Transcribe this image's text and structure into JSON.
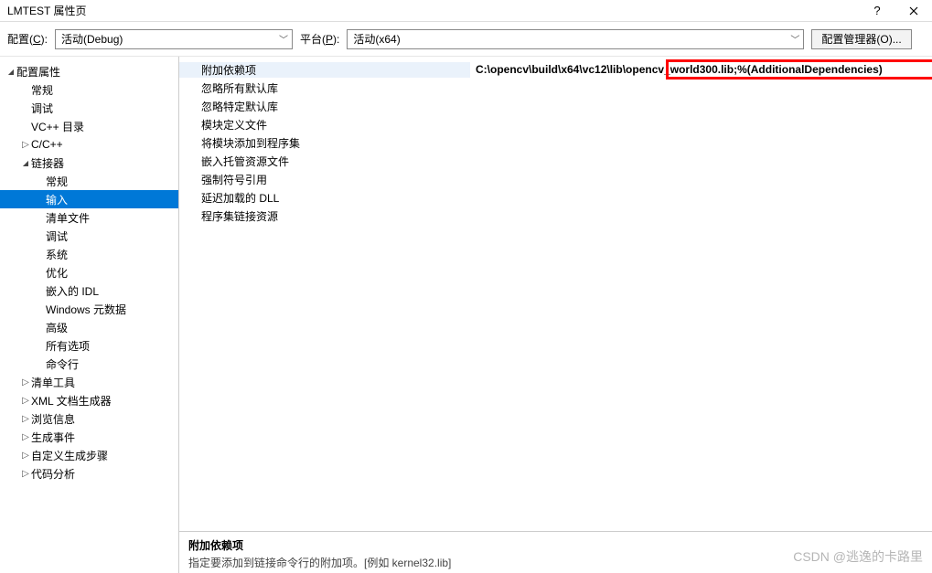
{
  "titlebar": {
    "title": "LMTEST 属性页"
  },
  "toolbar": {
    "config_label_pre": "配置(",
    "config_label_key": "C",
    "config_label_post": "):",
    "config_value": "活动(Debug)",
    "platform_label_pre": "平台(",
    "platform_label_key": "P",
    "platform_label_post": "):",
    "platform_value": "活动(x64)",
    "manager_label": "配置管理器(O)..."
  },
  "tree": [
    {
      "label": "配置属性",
      "indent": 0,
      "arrow": "▢",
      "selected": false
    },
    {
      "label": "常规",
      "indent": 1,
      "arrow": "",
      "selected": false
    },
    {
      "label": "调试",
      "indent": 1,
      "arrow": "",
      "selected": false
    },
    {
      "label": "VC++ 目录",
      "indent": 1,
      "arrow": "",
      "selected": false
    },
    {
      "label": "C/C++",
      "indent": 1,
      "arrow": "▷",
      "selected": false
    },
    {
      "label": "链接器",
      "indent": 1,
      "arrow": "▢",
      "selected": false
    },
    {
      "label": "常规",
      "indent": 2,
      "arrow": "",
      "selected": false
    },
    {
      "label": "输入",
      "indent": 2,
      "arrow": "",
      "selected": true
    },
    {
      "label": "清单文件",
      "indent": 2,
      "arrow": "",
      "selected": false
    },
    {
      "label": "调试",
      "indent": 2,
      "arrow": "",
      "selected": false
    },
    {
      "label": "系统",
      "indent": 2,
      "arrow": "",
      "selected": false
    },
    {
      "label": "优化",
      "indent": 2,
      "arrow": "",
      "selected": false
    },
    {
      "label": "嵌入的 IDL",
      "indent": 2,
      "arrow": "",
      "selected": false
    },
    {
      "label": "Windows 元数据",
      "indent": 2,
      "arrow": "",
      "selected": false
    },
    {
      "label": "高级",
      "indent": 2,
      "arrow": "",
      "selected": false
    },
    {
      "label": "所有选项",
      "indent": 2,
      "arrow": "",
      "selected": false
    },
    {
      "label": "命令行",
      "indent": 2,
      "arrow": "",
      "selected": false
    },
    {
      "label": "清单工具",
      "indent": 1,
      "arrow": "▷",
      "selected": false
    },
    {
      "label": "XML 文档生成器",
      "indent": 1,
      "arrow": "▷",
      "selected": false
    },
    {
      "label": "浏览信息",
      "indent": 1,
      "arrow": "▷",
      "selected": false
    },
    {
      "label": "生成事件",
      "indent": 1,
      "arrow": "▷",
      "selected": false
    },
    {
      "label": "自定义生成步骤",
      "indent": 1,
      "arrow": "▷",
      "selected": false
    },
    {
      "label": "代码分析",
      "indent": 1,
      "arrow": "▷",
      "selected": false
    }
  ],
  "properties": [
    {
      "label": "附加依赖项",
      "value": "C:\\opencv\\build\\x64\\vc12\\lib\\opencv_world300.lib;%(AdditionalDependencies)",
      "highlight": true
    },
    {
      "label": "忽略所有默认库",
      "value": "",
      "highlight": false
    },
    {
      "label": "忽略特定默认库",
      "value": "",
      "highlight": false
    },
    {
      "label": "模块定义文件",
      "value": "",
      "highlight": false
    },
    {
      "label": "将模块添加到程序集",
      "value": "",
      "highlight": false
    },
    {
      "label": "嵌入托管资源文件",
      "value": "",
      "highlight": false
    },
    {
      "label": "强制符号引用",
      "value": "",
      "highlight": false
    },
    {
      "label": "延迟加载的 DLL",
      "value": "",
      "highlight": false
    },
    {
      "label": "程序集链接资源",
      "value": "",
      "highlight": false
    }
  ],
  "description": {
    "title": "附加依赖项",
    "text": "指定要添加到链接命令行的附加项。[例如 kernel32.lib]"
  },
  "watermark": "CSDN @逃逸的卡路里"
}
